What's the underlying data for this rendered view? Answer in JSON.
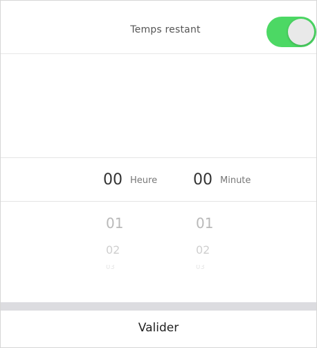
{
  "header": {
    "title": "Temps restant",
    "toggle_on": true,
    "toggle_color": "#4cd864"
  },
  "picker": {
    "hours": {
      "selected": "00",
      "unit": "Heure",
      "options": [
        "01",
        "02",
        "03"
      ]
    },
    "minutes": {
      "selected": "00",
      "unit": "Minute",
      "options": [
        "01",
        "02",
        "03"
      ]
    }
  },
  "footer": {
    "validate_label": "Valider"
  }
}
